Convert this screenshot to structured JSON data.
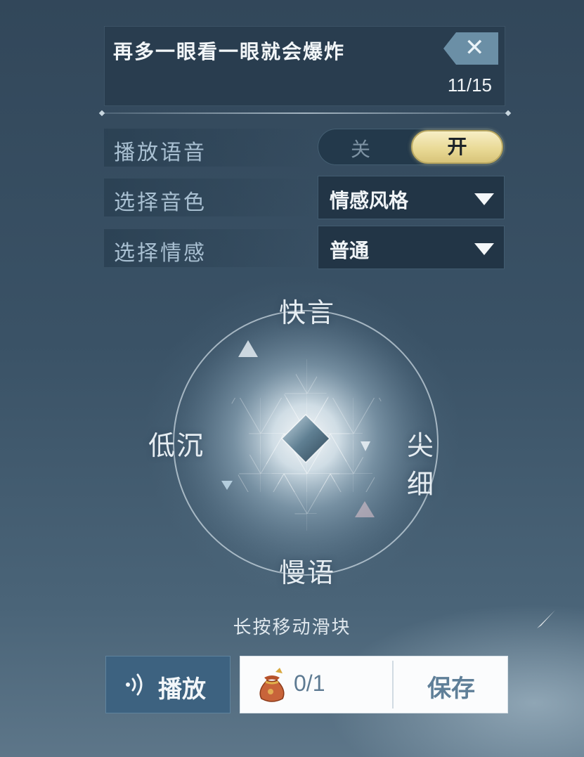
{
  "text_input": {
    "value": "再多一眼看一眼就会爆炸",
    "char_count": "11/15",
    "clear_icon": "close-icon"
  },
  "settings": {
    "voice_playback": {
      "label": "播放语音",
      "off_label": "关",
      "on_label": "开",
      "state": "on"
    },
    "timbre": {
      "label": "选择音色",
      "selected": "情感风格"
    },
    "emotion": {
      "label": "选择情感",
      "selected": "普通"
    }
  },
  "voice_pad": {
    "top_label": "快言",
    "bottom_label": "慢语",
    "left_label": "低沉",
    "right_label": "尖细",
    "hint": "长按移动滑块"
  },
  "footer": {
    "play_label": "播放",
    "play_icon": "sound-wave-icon",
    "item_icon": "pouch-icon",
    "item_count": "0/1",
    "save_label": "保存"
  },
  "colors": {
    "toggle_on": "#e8d893",
    "play_button": "#3d6280",
    "panel": "#263a4c"
  }
}
